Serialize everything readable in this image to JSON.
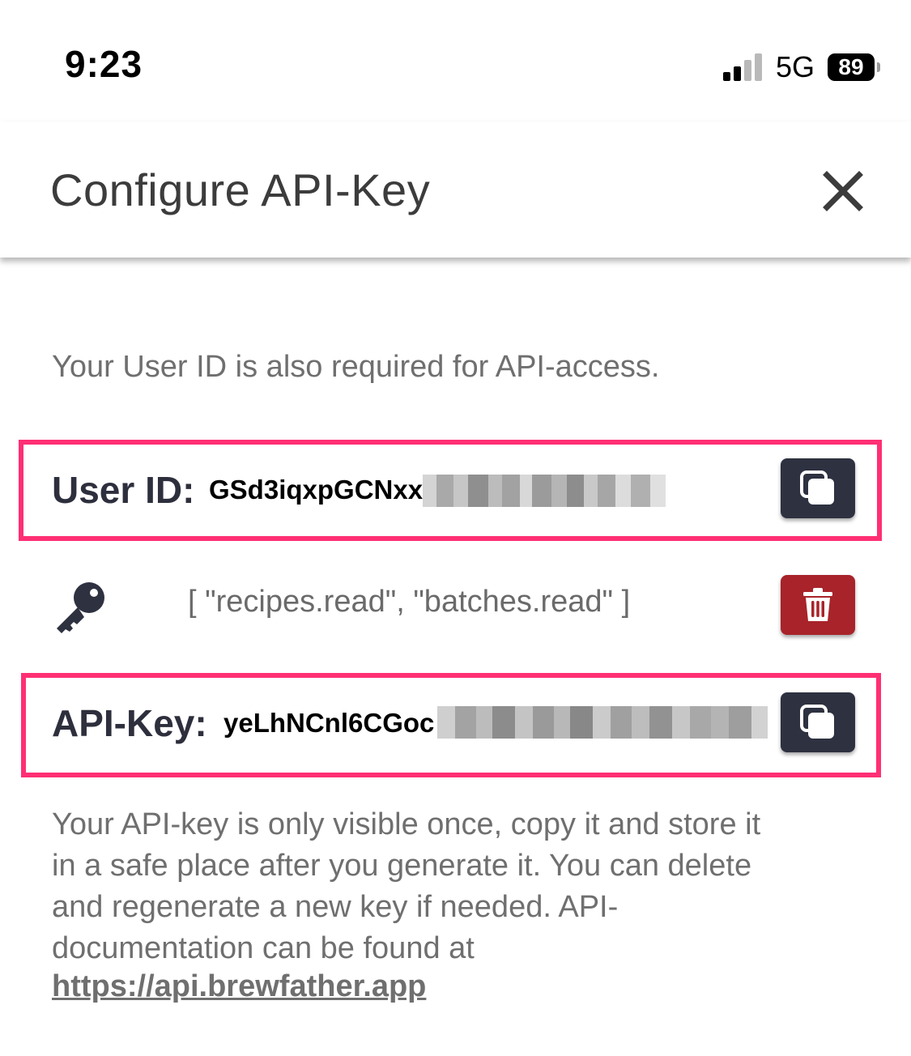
{
  "status_bar": {
    "time": "9:23",
    "network": "5G",
    "battery_level": "89"
  },
  "dialog": {
    "title": "Configure API-Key",
    "info": "Your User ID is also required for API-access.",
    "user_id": {
      "label": "User ID:",
      "value_visible": "GSd3iqxpGCNxx"
    },
    "key_scopes": "[ \"recipes.read\", \"batches.read\" ]",
    "api_key": {
      "label": "API-Key:",
      "value_visible": "yeLhNCnl6CGoc"
    },
    "note_lines": [
      "Your API-key is only visible once, copy it and store it",
      "in a safe place after you generate it. You can delete",
      "and regenerate a new key if needed. API-",
      "documentation can be found at"
    ],
    "doc_link": "https://api.brewfather.app"
  },
  "colors": {
    "highlight": "#ff2f74",
    "copy_button": "#2e3140",
    "delete_button": "#a8232a"
  },
  "icons": {
    "close": "close-icon",
    "copy": "copy-icon",
    "delete": "trash-icon",
    "key": "key-icon"
  }
}
